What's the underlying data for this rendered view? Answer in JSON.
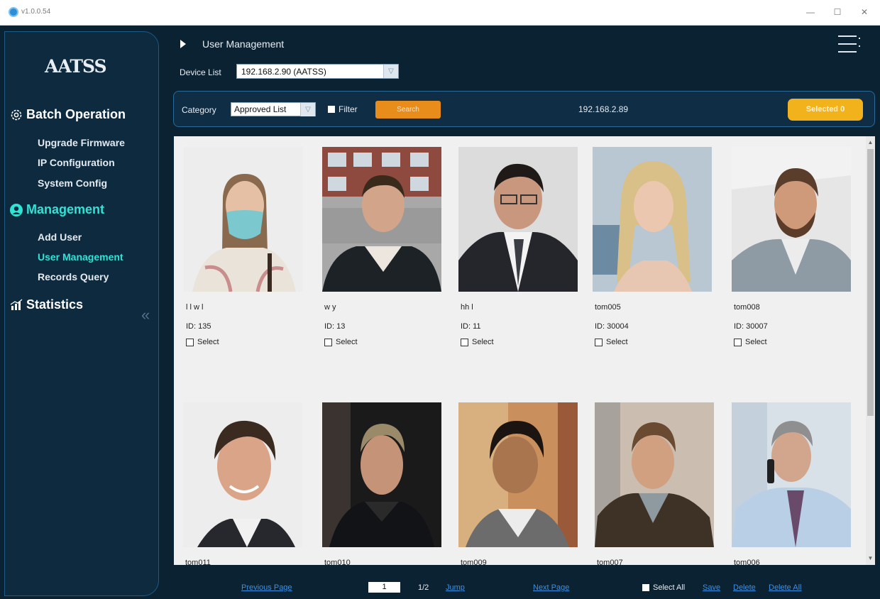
{
  "window": {
    "version": "v1.0.0.54",
    "minimize": "—",
    "maximize": "☐",
    "close": "✕"
  },
  "sidebar": {
    "logo": "AATSS",
    "collapse_glyph": "«",
    "sections": [
      {
        "label": "Batch Operation",
        "icon": "gear-icon",
        "active": false,
        "items": [
          {
            "label": "Upgrade Firmware"
          },
          {
            "label": "IP Configuration"
          },
          {
            "label": "System Config"
          }
        ]
      },
      {
        "label": "Management",
        "icon": "user-icon",
        "active": true,
        "items": [
          {
            "label": "Add User"
          },
          {
            "label": "User Management",
            "active": true
          },
          {
            "label": "Records Query"
          }
        ]
      },
      {
        "label": "Statistics",
        "icon": "chart-icon",
        "active": false,
        "items": []
      }
    ]
  },
  "header": {
    "breadcrumb": "User Management"
  },
  "device": {
    "label": "Device List",
    "value": "192.168.2.90 (AATSS)"
  },
  "filter": {
    "category_label": "Category",
    "category_value": "Approved List",
    "filter_label": "Filter",
    "search_label": "Search",
    "ip": "192.168.2.89",
    "selected_label": "Selected  0"
  },
  "users": [
    {
      "name": "l l w l",
      "id": "ID: 135",
      "select": "Select"
    },
    {
      "name": "w y",
      "id": "ID: 13",
      "select": "Select"
    },
    {
      "name": "hh l",
      "id": "ID: 11",
      "select": "Select"
    },
    {
      "name": "tom005",
      "id": "ID: 30004",
      "select": "Select"
    },
    {
      "name": "tom008",
      "id": "ID: 30007",
      "select": "Select"
    },
    {
      "name": "tom011"
    },
    {
      "name": "tom010"
    },
    {
      "name": "tom009"
    },
    {
      "name": "tom007"
    },
    {
      "name": "tom006"
    }
  ],
  "pager": {
    "prev": "Previous Page",
    "page": "1",
    "total": "1/2",
    "jump": "Jump",
    "next": "Next Page",
    "select_all": "Select All",
    "save": "Save",
    "delete": "Delete",
    "delete_all": "Delete All"
  },
  "colors": {
    "accent": "#2fe3d5",
    "search": "#e88c1b",
    "selected": "#f2b21b",
    "background": "#0b2233",
    "link": "#3d8fe0"
  }
}
